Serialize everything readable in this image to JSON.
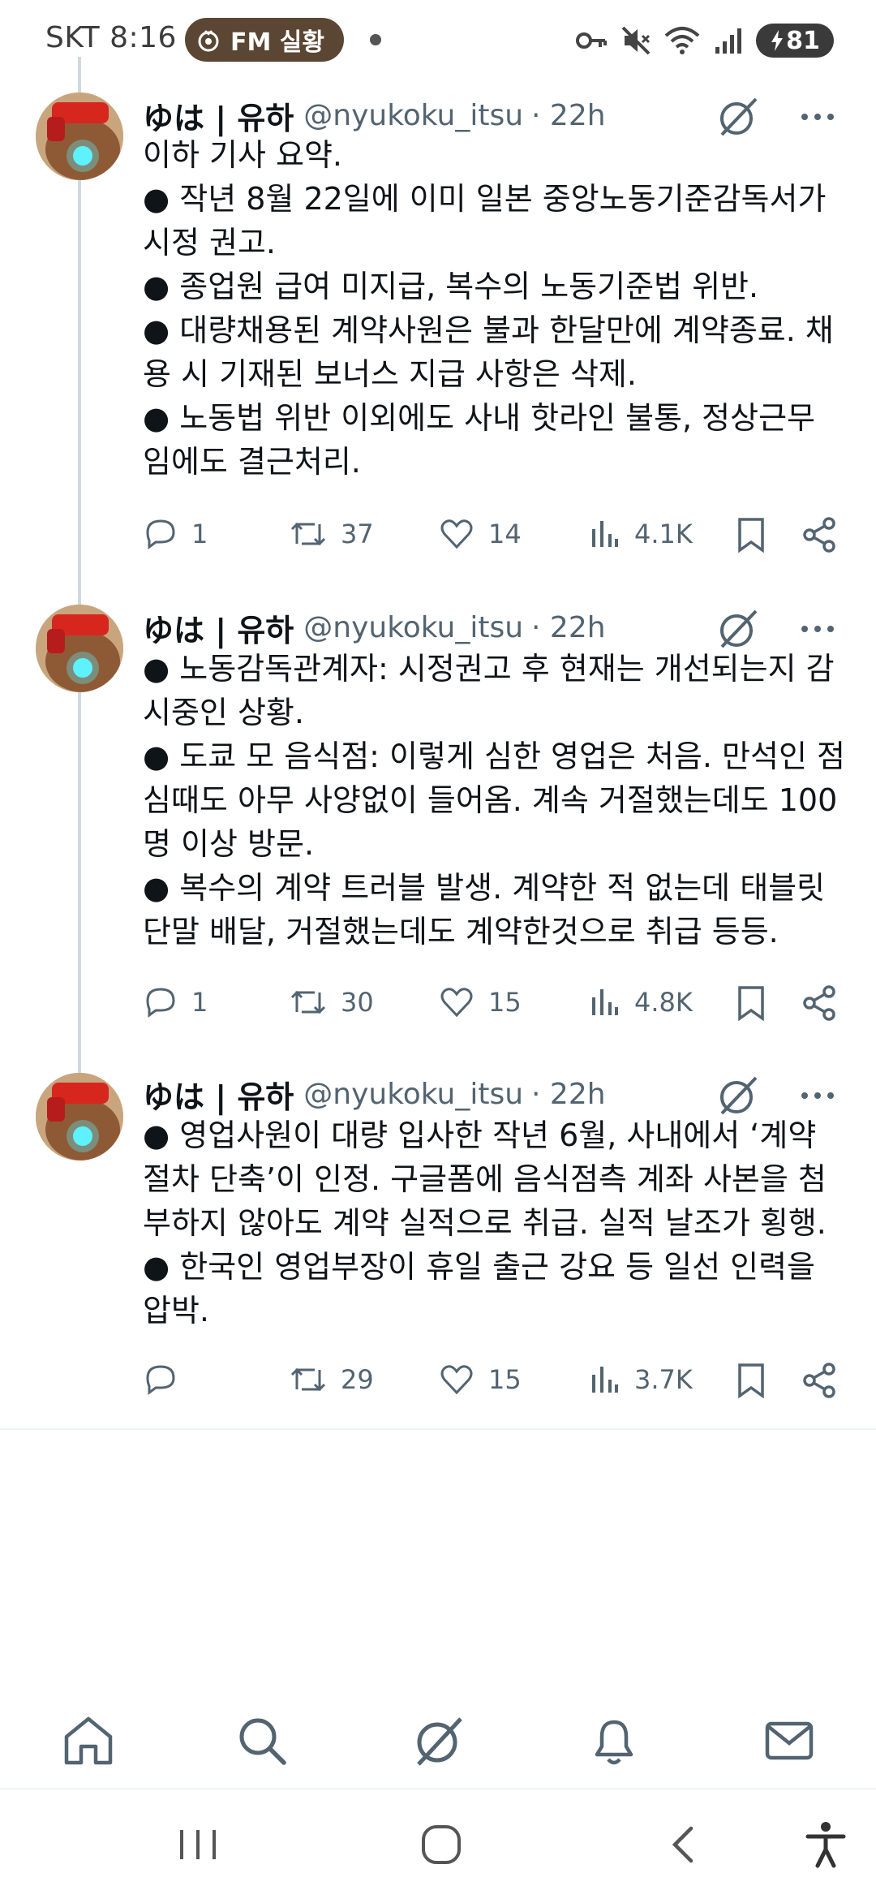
{
  "status_bar": {
    "carrier": "SKT",
    "time": "8:16",
    "pill_text": "FM 실황",
    "battery": "81"
  },
  "tweets": [
    {
      "name": "ゆは | 유하",
      "handle": "@nyukoku_itsu",
      "time": "· 22h",
      "lines": [
        "이하 기사 요약.",
        "● 작년 8월 22일에 이미 일본 중앙노동기준감독서가",
        "시정 권고.",
        "● 종업원 급여 미지급, 복수의 노동기준법 위반.",
        "● 대량채용된 계약사원은 불과 한달만에 계약종료. 채",
        "용 시 기재된 보너스 지급 사항은 삭제.",
        "● 노동법 위반 이외에도 사내 핫라인 불통, 정상근무",
        "임에도 결근처리."
      ],
      "replies": "1",
      "retweets": "37",
      "likes": "14",
      "views": "4.1K"
    },
    {
      "name": "ゆは | 유하",
      "handle": "@nyukoku_itsu",
      "time": "· 22h",
      "lines": [
        "● 노동감독관계자: 시정권고 후 현재는 개선되는지 감",
        "시중인 상황.",
        "● 도쿄 모 음식점: 이렇게 심한 영업은 처음. 만석인 점",
        "심때도 아무 사양없이 들어옴. 계속 거절했는데도 100",
        "명 이상 방문.",
        "● 복수의 계약 트러블 발생. 계약한 적 없는데 태블릿",
        "단말 배달, 거절했는데도 계약한것으로 취급 등등."
      ],
      "replies": "1",
      "retweets": "30",
      "likes": "15",
      "views": "4.8K"
    },
    {
      "name": "ゆは | 유하",
      "handle": "@nyukoku_itsu",
      "time": "· 22h",
      "lines": [
        "● 영업사원이 대량 입사한 작년 6월, 사내에서 ‘계약",
        "절차 단축’이 인정. 구글폼에 음식점측 계좌 사본을 첨",
        "부하지 않아도 계약 실적으로 취급. 실적 날조가 횡행.",
        "● 한국인 영업부장이 휴일 출근 강요 등 일선 인력을",
        "압박."
      ],
      "replies": "",
      "retweets": "29",
      "likes": "15",
      "views": "3.7K"
    }
  ],
  "bottom_nav": [
    "home-icon",
    "search-icon",
    "grok-icon",
    "notifications-icon",
    "messages-icon"
  ],
  "system_nav": [
    "recents-icon",
    "home-circle-icon",
    "back-icon",
    "accessibility-icon"
  ],
  "colors": {
    "text": "#0f1419",
    "secondary": "#536471",
    "thread": "#cfd9de",
    "pill": "#5a4632"
  }
}
